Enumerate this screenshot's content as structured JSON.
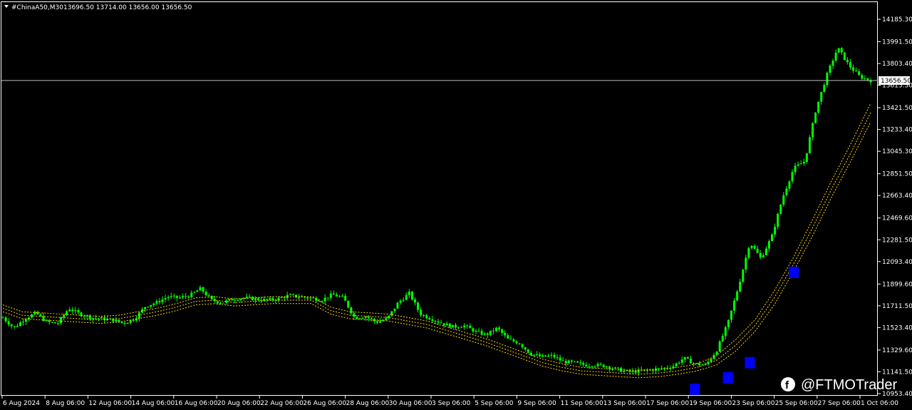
{
  "header": {
    "symbol": "#ChinaA50,M30",
    "ohlc": "13696.50 13714.00 13656.00 13656.50"
  },
  "watermark": {
    "text": "@FTMOTrader"
  },
  "colors": {
    "background": "#000000",
    "candle": "#00ff00",
    "ma_bands": "#ffd700",
    "signal": "#0000ff",
    "axis": "#ffffff",
    "price_line": "#c0c0c0"
  },
  "chart_data": {
    "type": "line",
    "price_marker": "13656.50",
    "ylim": [
      10953.4,
      14185.3
    ],
    "y_ticks": [
      "14185.30",
      "13991.50",
      "13803.40",
      "13615.30",
      "13421.50",
      "13233.40",
      "13045.30",
      "12851.50",
      "12663.40",
      "12469.60",
      "12281.50",
      "12093.40",
      "11899.60",
      "11711.50",
      "11523.40",
      "11329.60",
      "11141.50",
      "10953.40"
    ],
    "x_ticks": [
      "6 Aug 2024",
      "8 Aug 06:00",
      "12 Aug 06:00",
      "14 Aug 06:00",
      "16 Aug 06:00",
      "20 Aug 06:00",
      "22 Aug 06:00",
      "26 Aug 06:00",
      "28 Aug 06:00",
      "30 Aug 06:00",
      "3 Sep 06:00",
      "5 Sep 06:00",
      "9 Sep 06:00",
      "11 Sep 06:00",
      "13 Sep 06:00",
      "17 Sep 06:00",
      "19 Sep 06:00",
      "23 Sep 06:00",
      "25 Sep 06:00",
      "27 Sep 06:00",
      "1 Oct 06:00"
    ],
    "series": [
      {
        "values": [
          11610,
          11520,
          11600,
          11650,
          11570,
          11560,
          11690,
          11640,
          11610,
          11600,
          11590,
          11560,
          11600,
          11710,
          11740,
          11790,
          11780,
          11800,
          11860,
          11760,
          11740,
          11770,
          11780,
          11770,
          11760,
          11770,
          11800,
          11790,
          11780,
          11760,
          11810,
          11780,
          11610,
          11620,
          11570,
          11600,
          11740,
          11820,
          11640,
          11600,
          11560,
          11530,
          11540,
          11490,
          11460,
          11520,
          11420,
          11390,
          11300,
          11270,
          11280,
          11230,
          11220,
          11200,
          11200,
          11190,
          11160,
          11140,
          11150,
          11160,
          11170,
          11190,
          11260,
          11210,
          11200,
          11330,
          11560,
          11890,
          12260,
          12120,
          12310,
          12650,
          12900,
          12960,
          13400,
          13700,
          13940,
          13790,
          13690,
          13656
        ]
      }
    ],
    "ma_bands": [
      [
        11720,
        11660,
        11650,
        11640,
        11630,
        11620,
        11630,
        11660,
        11690,
        11730,
        11780,
        11790,
        11770,
        11780,
        11790,
        11790,
        11790,
        11700,
        11660,
        11650,
        11640,
        11610,
        11580,
        11530,
        11480,
        11430,
        11370,
        11310,
        11250,
        11210,
        11180,
        11170,
        11160,
        11150,
        11160,
        11180,
        11210,
        11280,
        11420,
        11590,
        11840,
        12130,
        12460,
        12800,
        13120,
        13460
      ],
      [
        11690,
        11630,
        11620,
        11610,
        11600,
        11590,
        11600,
        11630,
        11660,
        11700,
        11750,
        11760,
        11740,
        11750,
        11760,
        11760,
        11760,
        11670,
        11630,
        11620,
        11610,
        11580,
        11550,
        11500,
        11450,
        11400,
        11340,
        11280,
        11220,
        11180,
        11150,
        11140,
        11130,
        11120,
        11130,
        11150,
        11180,
        11240,
        11370,
        11540,
        11780,
        12070,
        12390,
        12730,
        13040,
        13380
      ],
      [
        11660,
        11600,
        11590,
        11580,
        11570,
        11560,
        11570,
        11600,
        11630,
        11670,
        11720,
        11730,
        11710,
        11720,
        11730,
        11730,
        11730,
        11640,
        11600,
        11590,
        11580,
        11550,
        11520,
        11470,
        11420,
        11370,
        11310,
        11250,
        11190,
        11150,
        11120,
        11110,
        11100,
        11090,
        11100,
        11120,
        11150,
        11200,
        11320,
        11490,
        11720,
        12010,
        12320,
        12660,
        12970,
        13300
      ]
    ],
    "signals": [
      {
        "x_index": 63,
        "value": 10990
      },
      {
        "x_index": 66,
        "value": 11090
      },
      {
        "x_index": 68,
        "value": 11220
      },
      {
        "x_index": 72,
        "value": 12000
      }
    ],
    "grid": false
  }
}
